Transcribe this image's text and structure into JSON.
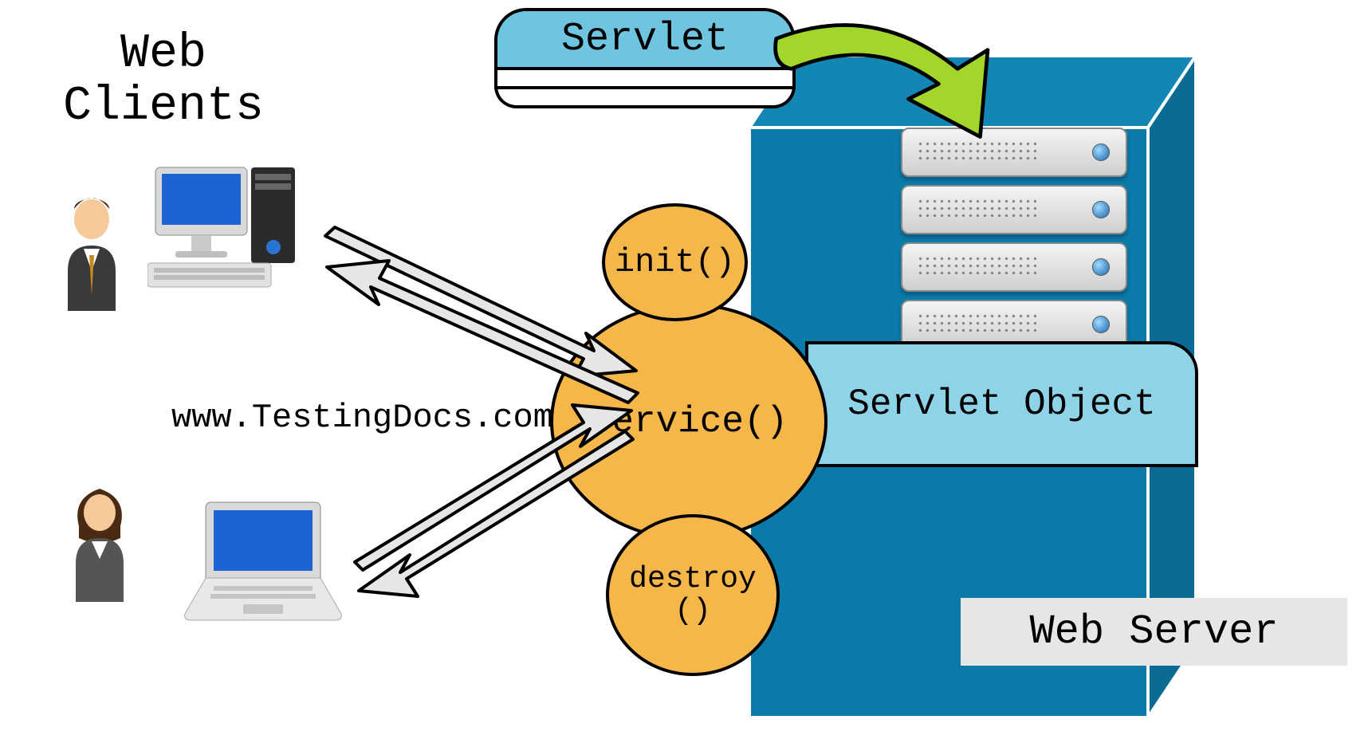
{
  "labels": {
    "web_clients": "Web\nClients",
    "servlet": "Servlet",
    "servlet_object": "Servlet\nObject",
    "web_server": "Web Server",
    "watermark": "www.TestingDocs.com"
  },
  "lifecycle": {
    "init": "init()",
    "service": "service()",
    "destroy": "destroy\n()"
  },
  "colors": {
    "cube": "#0a7aa8",
    "cube_dark": "#0a6f9a",
    "circle": "#f6b74a",
    "cap": "#6fc5e0",
    "servlet_obj": "#8fd3e8",
    "green_arrow": "#a4d52b",
    "grey_fill": "#e6e6e6"
  }
}
